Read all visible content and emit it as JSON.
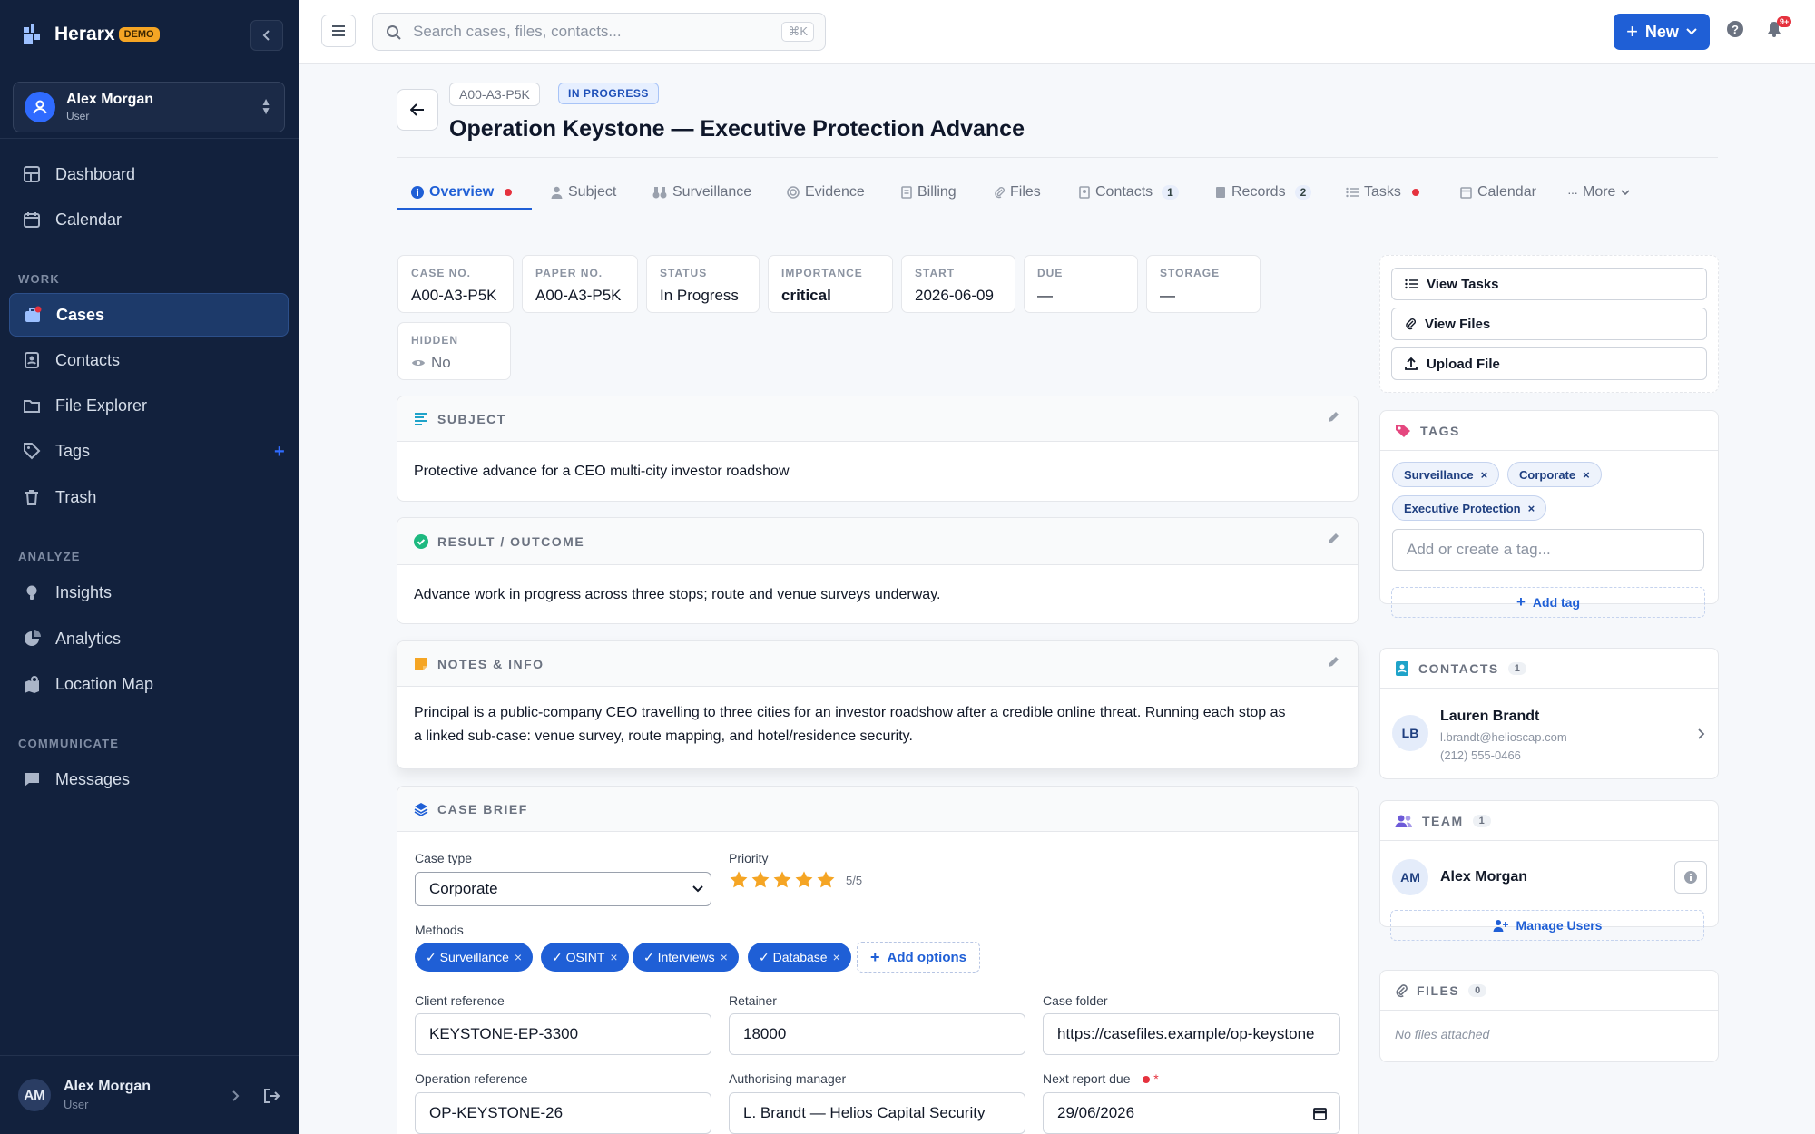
{
  "brand": {
    "name": "Herarx",
    "badge": "DEMO"
  },
  "user_card": {
    "name": "Alex Morgan",
    "role": "User"
  },
  "nav": {
    "dashboard": "Dashboard",
    "calendar": "Calendar",
    "work_label": "WORK",
    "cases": "Cases",
    "contacts": "Contacts",
    "file_explorer": "File Explorer",
    "tags": "Tags",
    "trash": "Trash",
    "analyze_label": "ANALYZE",
    "insights": "Insights",
    "analytics": "Analytics",
    "location_map": "Location Map",
    "communicate_label": "COMMUNICATE",
    "messages": "Messages"
  },
  "bottom_user": {
    "initials": "AM",
    "name": "Alex Morgan",
    "role": "User"
  },
  "topbar": {
    "search_placeholder": "Search cases, files, contacts...",
    "shortcut": "⌘K",
    "new_label": "New",
    "notif_count": "9+"
  },
  "case": {
    "id_chip": "A00-A3-P5K",
    "status_chip": "IN PROGRESS",
    "title": "Operation Keystone — Executive Protection Advance"
  },
  "tabs": [
    {
      "label": "Overview"
    },
    {
      "label": "Subject"
    },
    {
      "label": "Surveillance"
    },
    {
      "label": "Evidence"
    },
    {
      "label": "Billing"
    },
    {
      "label": "Files"
    },
    {
      "label": "Contacts",
      "count": "1"
    },
    {
      "label": "Records",
      "count": "2"
    },
    {
      "label": "Tasks"
    },
    {
      "label": "Calendar"
    },
    {
      "label": "More"
    }
  ],
  "stats": [
    {
      "label": "CASE NO.",
      "value": "A00-A3-P5K"
    },
    {
      "label": "PAPER NO.",
      "value": "A00-A3-P5K"
    },
    {
      "label": "STATUS",
      "value": "In Progress"
    },
    {
      "label": "IMPORTANCE",
      "value": "critical"
    },
    {
      "label": "START",
      "value": "2026-06-09"
    },
    {
      "label": "DUE",
      "value": "—"
    },
    {
      "label": "STORAGE",
      "value": "—"
    },
    {
      "label": "HIDDEN",
      "value": "No"
    }
  ],
  "subject": {
    "heading": "SUBJECT",
    "text": "Protective advance for a CEO multi-city investor roadshow"
  },
  "result": {
    "heading": "RESULT / OUTCOME",
    "text": "Advance work in progress across three stops; route and venue surveys underway."
  },
  "notes": {
    "heading": "NOTES & INFO",
    "line1": "Principal is a public-company CEO travelling to three cities for an investor roadshow after a credible online threat. Running each stop as",
    "line2": "a linked sub-case: venue survey, route mapping, and hotel/residence security."
  },
  "brief": {
    "heading": "CASE BRIEF",
    "case_type_label": "Case type",
    "case_type_value": "Corporate",
    "priority_label": "Priority",
    "priority_value": 5,
    "priority_text": "5/5",
    "methods_label": "Methods",
    "methods": [
      "✓ Surveillance",
      "✓ OSINT",
      "✓ Interviews",
      "✓ Database"
    ],
    "add_options": "Add options",
    "client_ref_label": "Client reference",
    "client_ref": "KEYSTONE-EP-3300",
    "retainer_label": "Retainer",
    "retainer": "18000",
    "case_folder_label": "Case folder",
    "case_folder": "https://casefiles.example/op-keystone",
    "op_ref_label": "Operation reference",
    "op_ref": "OP-KEYSTONE-26",
    "manager_label": "Authorising manager",
    "manager": "L. Brandt — Helios Capital Security",
    "report_due_label": "Next report due",
    "report_due_required": "*",
    "report_due": "29/06/2026"
  },
  "actions": {
    "view_tasks": "View Tasks",
    "view_files": "View Files",
    "upload_file": "Upload File"
  },
  "tags_card": {
    "heading": "TAGS",
    "tags": [
      "Surveillance",
      "Corporate",
      "Executive Protection"
    ],
    "placeholder": "Add or create a tag...",
    "add": "Add tag"
  },
  "contacts_card": {
    "heading": "CONTACTS",
    "count": "1",
    "initials": "LB",
    "name": "Lauren Brandt",
    "email": "l.brandt@helioscap.com",
    "phone": "(212) 555-0466"
  },
  "team_card": {
    "heading": "TEAM",
    "count": "1",
    "initials": "AM",
    "name": "Alex Morgan",
    "manage": "Manage Users"
  },
  "files_card": {
    "heading": "FILES",
    "count": "0",
    "empty": "No files attached"
  },
  "colors": {
    "sidebar": "#12213d",
    "accent": "#1f5fd6",
    "danger": "#e5323e",
    "star": "#f5a524"
  }
}
